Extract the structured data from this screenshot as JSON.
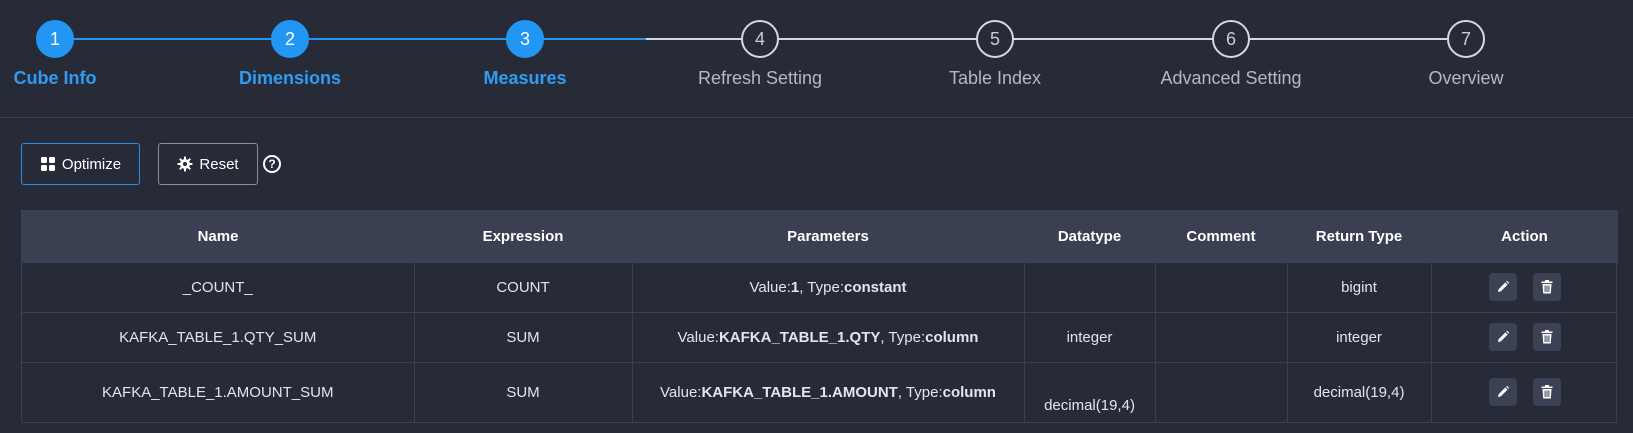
{
  "stepper": {
    "steps": [
      {
        "number": "1",
        "label": "Cube Info",
        "state": "done"
      },
      {
        "number": "2",
        "label": "Dimensions",
        "state": "done"
      },
      {
        "number": "3",
        "label": "Measures",
        "state": "done"
      },
      {
        "number": "4",
        "label": "Refresh Setting",
        "state": "todo"
      },
      {
        "number": "5",
        "label": "Table Index",
        "state": "todo"
      },
      {
        "number": "6",
        "label": "Advanced Setting",
        "state": "todo"
      },
      {
        "number": "7",
        "label": "Overview",
        "state": "todo"
      }
    ],
    "colors": {
      "active": "#2196f3",
      "inactive": "#d5d8de"
    }
  },
  "toolbar": {
    "optimize_label": "Optimize",
    "optimize_icon": "grid-icon",
    "reset_label": "Reset",
    "reset_icon": "gear-icon",
    "help_icon": "question-circle-icon"
  },
  "table": {
    "headers": [
      "Name",
      "Expression",
      "Parameters",
      "Datatype",
      "Comment",
      "Return Type",
      "Action"
    ],
    "rows": [
      {
        "name": "_COUNT_",
        "expression": "COUNT",
        "param_value_prefix": "Value:",
        "param_value": "1",
        "param_type_prefix": ", Type:",
        "param_type": "constant",
        "datatype": "",
        "comment": "",
        "return_type": "bigint"
      },
      {
        "name": "KAFKA_TABLE_1.QTY_SUM",
        "expression": "SUM",
        "param_value_prefix": "Value:",
        "param_value": "KAFKA_TABLE_1.QTY",
        "param_type_prefix": ", Type:",
        "param_type": "column",
        "datatype": "integer",
        "comment": "",
        "return_type": "integer"
      },
      {
        "name": "KAFKA_TABLE_1.AMOUNT_SUM",
        "expression": "SUM",
        "param_value_prefix": "Value:",
        "param_value": "KAFKA_TABLE_1.AMOUNT",
        "param_type_prefix": ", Type:",
        "param_type": "column",
        "datatype": "decimal(19,4)",
        "comment": "",
        "return_type": "decimal(19,4)"
      }
    ],
    "action_icons": [
      "pencil-icon",
      "trash-icon"
    ]
  }
}
